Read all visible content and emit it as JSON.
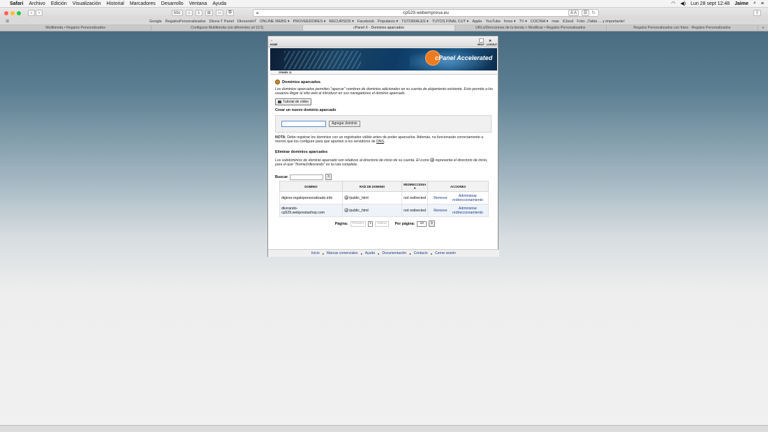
{
  "menubar": {
    "app": "Safari",
    "items": [
      "Archivo",
      "Edición",
      "Visualización",
      "Historial",
      "Marcadores",
      "Desarrollo",
      "Ventana",
      "Ayuda"
    ],
    "clock": "Lun 28 sept  12:48",
    "user": "Jaime"
  },
  "toolbar": {
    "url": "cp529.webempresa.eu",
    "reader_label": "bbc",
    "text_size": "A A"
  },
  "bookmarks": [
    "Google",
    "RegalosPersonalizados",
    "Dkora-T Panel",
    "DkorandoT",
    "ONLINE WEBS ▾",
    "PROVEEDORES ▾",
    "RECURSOS ▾",
    "Facebook",
    "Populares ▾",
    "TUTORIALES ▾",
    "TUTOS FINAL CUT ▾",
    "Apple",
    "YouTube",
    "foros ▾",
    "TV ▾",
    "COCINA ▾",
    "max",
    "iCloud",
    "Foto: ¡Tabla ... y importante!"
  ],
  "tabs": [
    {
      "label": "Multitienda • Regalos Personalizados",
      "active": false
    },
    {
      "label": "Configurar Multitienda con diferentes url (1/1)",
      "active": false
    },
    {
      "label": "cPanel X - Dominios aparcados",
      "active": true
    },
    {
      "label": "URLs/Direcciones de la tienda > Modificar • Regalos Personalizados",
      "active": false
    },
    {
      "label": "Regalos Personalizados con fotos - Regalos Personalizados",
      "active": false
    }
  ],
  "cpanel": {
    "top": {
      "home": "HOME",
      "help": "HELP",
      "logout": "LOGOUT"
    },
    "banner_logo": "cPanel Accelerated",
    "breadcrumb": "CPANEL 11",
    "title": "Dominios aparcados",
    "description": "Los dominios aparcados permiten \"aparcar\" nombres de dominios adicionales en su cuenta de alojamiento existente. Esto permite a los usuarios llegar al sitio web al introducir en sus navegadores el dominio aparcado.",
    "video_button": "Tutorial de vídeo",
    "create_heading": "Crear un nuevo dominio aparcado",
    "domain_input_value": "",
    "add_button": "Agregar dominio",
    "note_label": "NOTA",
    "note_text": ": Debe registrar los dominios con un registrador válido antes de poder aparcarlos. Además, no funcionarán correctamente a menos que los configure para que apunten a los servidores de ",
    "note_dns": "DNS",
    "note_end": ".",
    "remove_heading": "Eliminar dominios aparcados",
    "remove_desc_1": "Los subdominios de dominio aparcado son relativos al directorio de inicio de su cuenta. El icono",
    "remove_desc_2": "representa el directorio de inicio, para el que \"/home2/dkorando\" es la ruta completa.",
    "search_label": "Buscar",
    "search_value": "",
    "go": "Ir",
    "table": {
      "headers": [
        "Dominio",
        "Raíz de dominio",
        "Redirecciona a",
        "Acciones"
      ],
      "rows": [
        {
          "domain": "diginor.regalopersonalizado.info",
          "root": "/public_html",
          "redirect": "not redirected",
          "remove": "Remove",
          "manage": "Administrar redireccionamiento"
        },
        {
          "domain": "dkorando-cp529.webprestashop.com",
          "root": "/public_html",
          "redirect": "not redirected",
          "remove": "Remove",
          "manage": "Administrar redireccionamiento"
        }
      ]
    },
    "pager": {
      "label": "Página:",
      "first": "Primero",
      "page": "1",
      "last": "Último",
      "per_page_label": "Por página:",
      "per_page": "10",
      "go": "Ir"
    },
    "footer": [
      "Inicio",
      "Marcas comerciales",
      "Ayuda",
      "Documentación",
      "Contacto",
      "Cerrar sesión"
    ]
  }
}
